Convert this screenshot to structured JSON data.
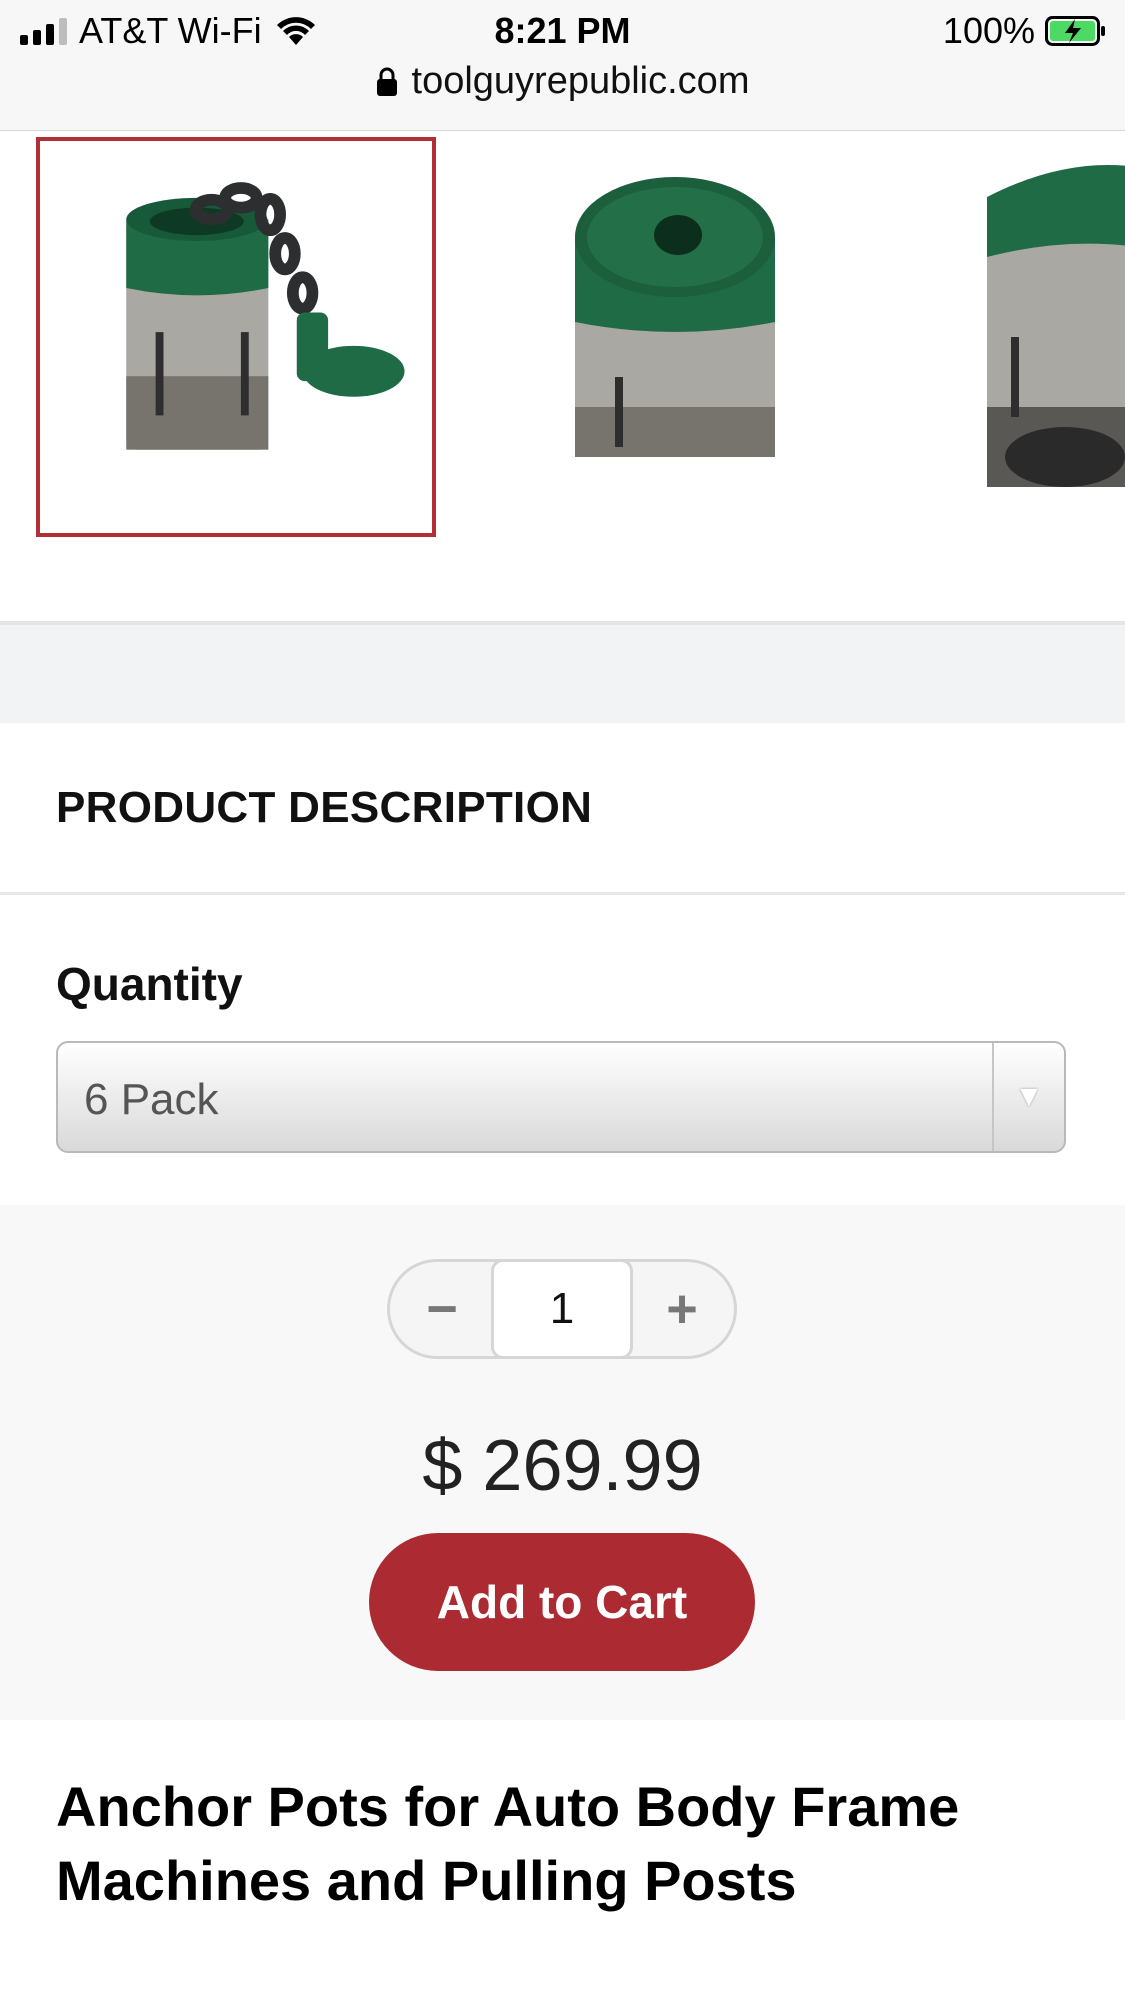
{
  "status_bar": {
    "carrier": "AT&T Wi-Fi",
    "time": "8:21 PM",
    "battery": "100%",
    "url": "toolguyrepublic.com"
  },
  "gallery": {
    "selected_index": 0,
    "accent_color": "#b03035"
  },
  "description": {
    "title": "PRODUCT DESCRIPTION"
  },
  "quantity": {
    "label": "Quantity",
    "selected_option": "6 Pack"
  },
  "purchase": {
    "minus_label": "−",
    "plus_label": "+",
    "quantity_value": "1",
    "price": "$ 269.99",
    "add_to_cart_label": "Add to Cart",
    "button_color": "#ac2b33"
  },
  "product": {
    "title": "Anchor Pots for Auto Body Frame Machines and Pulling Posts"
  }
}
